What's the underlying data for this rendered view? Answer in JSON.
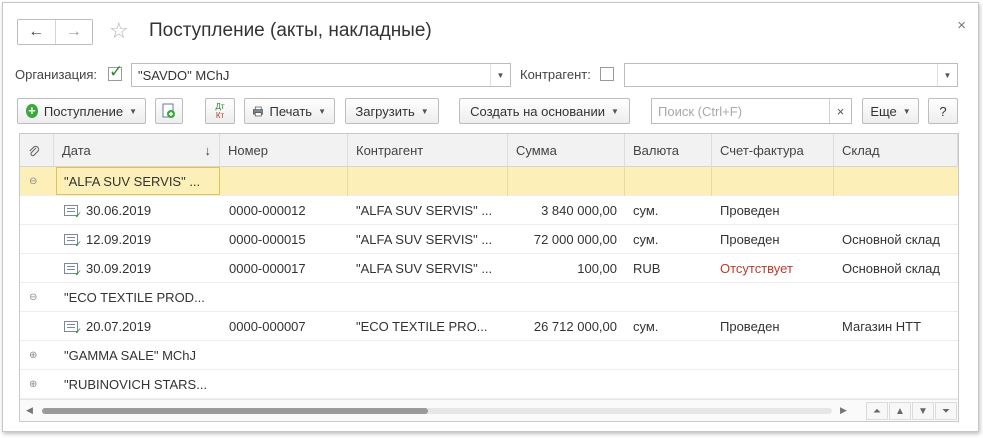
{
  "window": {
    "title": "Поступление (акты, накладные)",
    "back_icon": "←",
    "forward_icon": "→",
    "star_icon": "☆",
    "close_icon": "×"
  },
  "filters": {
    "org_label": "Организация:",
    "org_value": "\"SAVDO\" MChJ",
    "contractor_label": "Контрагент:",
    "contractor_value": ""
  },
  "toolbar": {
    "receipt_label": "Поступление",
    "print_label": "Печать",
    "load_label": "Загрузить",
    "create_based_label": "Создать на основании",
    "search_placeholder": "Поиск (Ctrl+F)",
    "search_clear": "×",
    "more_label": "Еще",
    "help_label": "?",
    "dtkt_top": "Дт",
    "dtkt_bottom": "Кт"
  },
  "table": {
    "columns": [
      "Дата",
      "Номер",
      "Контрагент",
      "Сумма",
      "Валюта",
      "Счет-фактура",
      "Склад"
    ],
    "sort_indicator": "↓",
    "group_collapse": "⊖",
    "group_expand": "⊕",
    "rows": [
      {
        "type": "group",
        "name": "\"ALFA SUV SERVIS\" ...",
        "expanded": true,
        "selected": true
      },
      {
        "type": "doc",
        "date": "30.06.2019",
        "number": "0000-000012",
        "contractor": "\"ALFA SUV SERVIS\" ...",
        "amount": "3 840 000,00",
        "currency": "сум.",
        "invoice": "Проведен",
        "warehouse": ""
      },
      {
        "type": "doc",
        "date": "12.09.2019",
        "number": "0000-000015",
        "contractor": "\"ALFA SUV SERVIS\" ...",
        "amount": "72 000 000,00",
        "currency": "сум.",
        "invoice": "Проведен",
        "warehouse": "Основной склад"
      },
      {
        "type": "doc",
        "date": "30.09.2019",
        "number": "0000-000017",
        "contractor": "\"ALFA SUV SERVIS\" ...",
        "amount": "100,00",
        "currency": "RUB",
        "invoice": "Отсутствует",
        "warehouse": "Основной склад"
      },
      {
        "type": "group",
        "name": "\"ECO TEXTILE PROD...",
        "expanded": true
      },
      {
        "type": "doc",
        "date": "20.07.2019",
        "number": "0000-000007",
        "contractor": "\"ECO TEXTILE PRO...",
        "amount": "26 712 000,00",
        "currency": "сум.",
        "invoice": "Проведен",
        "warehouse": "Магазин НТТ"
      },
      {
        "type": "group",
        "name": "\"GAMMA SALE\" MChJ",
        "expanded": false
      },
      {
        "type": "group",
        "name": "\"RUBINOVICH STARS...",
        "expanded": false
      }
    ]
  },
  "colors": {
    "selected_row": "#fcefb8",
    "status_missing": "#c0392b",
    "accent_green": "#3aa83a"
  }
}
